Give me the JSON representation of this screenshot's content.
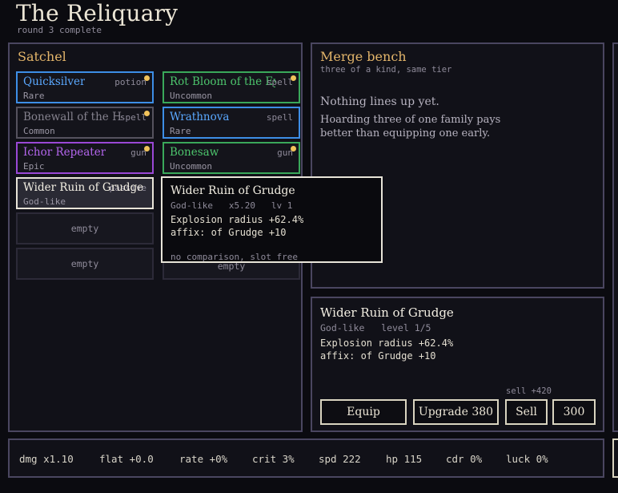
{
  "header": {
    "title": "The Reliquary",
    "subtitle": "round 3 complete"
  },
  "satchel": {
    "title": "Satchel",
    "slots": [
      {
        "name": "Quicksilver",
        "tag": "potion",
        "rarity": "Rare",
        "new": true
      },
      {
        "name": "Rot Bloom of the Eye",
        "tag": "spell",
        "rarity": "Uncommon",
        "new": true
      },
      {
        "name": "Bonewall of the House",
        "tag": "spell",
        "rarity": "Common",
        "new": true
      },
      {
        "name": "Wrathnova",
        "tag": "spell",
        "rarity": "Rare",
        "new": false
      },
      {
        "name": "Ichor Repeater",
        "tag": "gun",
        "rarity": "Epic",
        "new": true
      },
      {
        "name": "Bonesaw",
        "tag": "gun",
        "rarity": "Uncommon",
        "new": true
      },
      {
        "name": "Wider Ruin of Grudge",
        "tag": "passive",
        "rarity": "God-like",
        "new": false
      },
      {
        "name": "",
        "tag": "",
        "rarity": "",
        "new": false
      }
    ],
    "empty_label": "empty"
  },
  "tooltip": {
    "name": "Wider Ruin of Grudge",
    "meta": "God-like   x5.20   lv 1",
    "stat1": "Explosion radius +62.4%",
    "stat2": "affix: of Grudge +10",
    "footer": "no comparison, slot free"
  },
  "merge": {
    "title": "Merge bench",
    "subtitle": "three of a kind, same tier",
    "message": "Nothing lines up yet.",
    "hint": "Hoarding three of one family pays better than equipping one early."
  },
  "detail": {
    "name": "Wider Ruin of Grudge",
    "meta": "God-like   level 1/5",
    "stat1": "Explosion radius +62.4%",
    "stat2": "affix: of Grudge +10",
    "sell_hint": "sell +420",
    "equip_label": "Equip",
    "upgrade_label": "Upgrade 380",
    "sell_label": "Sell",
    "sell_value": "300"
  },
  "stats": {
    "dmg": "dmg x1.10",
    "flat": "flat +0.0",
    "rate": "rate +0%",
    "crit": "crit 3%",
    "spd": "spd 222",
    "hp": "hp 115",
    "cdr": "cdr 0%",
    "luck": "luck 0%"
  },
  "colors": {
    "accent": "#e3b56a",
    "rare": "#3d8ee6",
    "uncommon": "#3aa85a",
    "epic": "#9a48d6",
    "common": "#55525e",
    "godlike": "#e8e4d8",
    "new_dot": "#f0c25a"
  }
}
